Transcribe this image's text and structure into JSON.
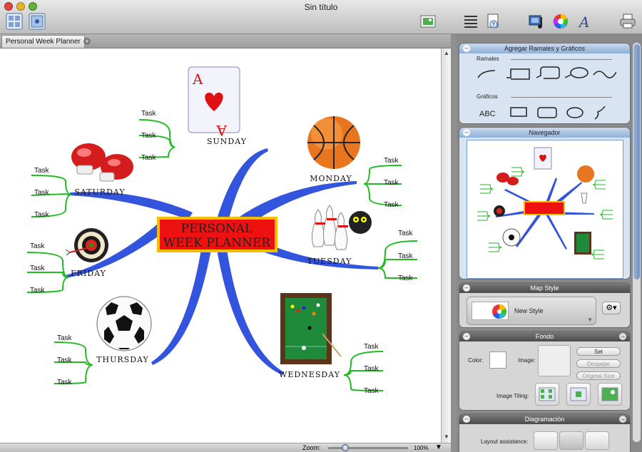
{
  "window": {
    "title": "Sin título"
  },
  "tabs": [
    {
      "label": "Personal  Week Planner"
    }
  ],
  "map": {
    "central_line1": "PERSONAL",
    "central_line2": "WEEK PLANNER",
    "days": {
      "sunday": "SUNDAY",
      "monday": "MONDAY",
      "tuesday": "TUESDAY",
      "wednesday": "WEDNESDAY",
      "thursday": "THURSDAY",
      "friday": "FRIDAY",
      "saturday": "SATURDAY"
    },
    "task_label": "Task",
    "card_rank": "A"
  },
  "status": {
    "zoom_label": "Zoom:",
    "zoom_value": "100%"
  },
  "panels": {
    "ramales_title": "Agregar Ramales y Gráficos",
    "ramales_label": "Ramales",
    "graficos_label": "Gráficos",
    "graficos_text_icon": "ABC",
    "navegador_title": "Navegador",
    "mapstyle_title": "Map Style",
    "style_name": "New Style",
    "fondo_title": "Fondo",
    "color_label": "Color:",
    "image_label": "Image:",
    "set_label": "Set",
    "despejar_label": "Despejar",
    "original_size_label": "Original Size",
    "tiling_label": "Image Tiling:",
    "diagramacion_title": "Diagramación",
    "layout_label": "Layout assistance:"
  },
  "colors": {
    "branch": "#3355dd",
    "task_line": "#22bb22",
    "central_bg": "#ee1111",
    "central_border": "#f0c000",
    "central_text": "#222222"
  },
  "icons": [
    "outline-view-icon",
    "layout-view-icon",
    "photo-icon",
    "notes-icon",
    "document-icon",
    "music-icon",
    "color-wheel-icon",
    "font-icon",
    "print-icon"
  ]
}
